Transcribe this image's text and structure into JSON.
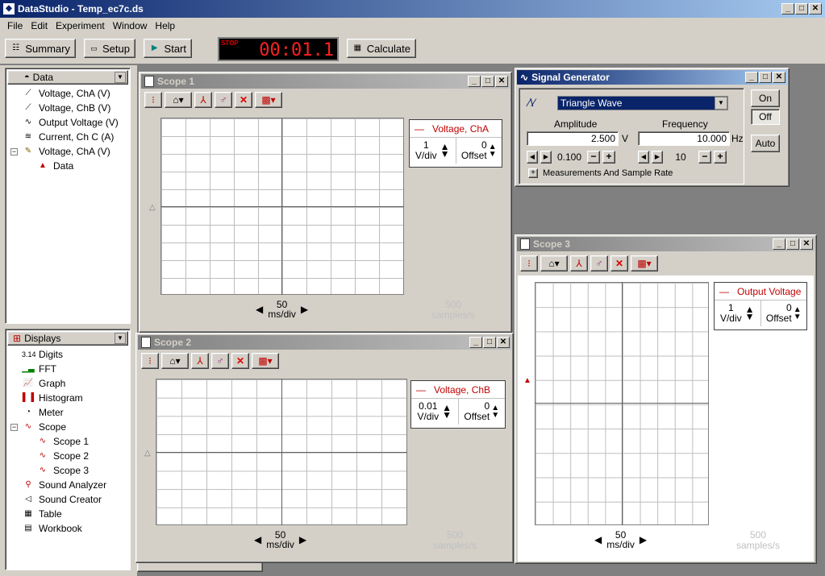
{
  "window": {
    "title": "DataStudio - Temp_ec7c.ds",
    "app_icon": "datastudio-icon"
  },
  "menu": [
    "File",
    "Edit",
    "Experiment",
    "Window",
    "Help"
  ],
  "toolbar": {
    "summary": "Summary",
    "setup": "Setup",
    "start": "Start",
    "timer": "00:01.1",
    "stop": "STOP",
    "calculate": "Calculate"
  },
  "data_panel": {
    "header": "Data",
    "items": [
      "Voltage, ChA (V)",
      "Voltage, ChB (V)",
      "Output Voltage (V)",
      "Current, Ch C (A)",
      "Voltage, ChA (V)",
      "Data"
    ]
  },
  "displays_panel": {
    "header": "Displays",
    "items": [
      "Digits",
      "FFT",
      "Graph",
      "Histogram",
      "Meter",
      "Scope",
      "Scope 1",
      "Scope 2",
      "Scope 3",
      "Sound Analyzer",
      "Sound Creator",
      "Table",
      "Workbook"
    ],
    "digits_icon": "3.14"
  },
  "scope1": {
    "title": "Scope 1",
    "legend": "Voltage, ChA",
    "vdiv": "1",
    "vdiv_unit": "V/div",
    "offset": "0",
    "offset_label": "Offset",
    "time": "50",
    "time_unit": "ms/div",
    "rate": "500",
    "rate_unit": "samples/s"
  },
  "scope2": {
    "title": "Scope 2",
    "legend": "Voltage, ChB",
    "vdiv": "0.01",
    "vdiv_unit": "V/div",
    "offset": "0",
    "offset_label": "Offset",
    "time": "50",
    "time_unit": "ms/div",
    "rate": "500",
    "rate_unit": "samples/s"
  },
  "scope3": {
    "title": "Scope 3",
    "legend": "Output Voltage",
    "vdiv": "1",
    "vdiv_unit": "V/div",
    "offset": "0",
    "offset_label": "Offset",
    "time": "50",
    "time_unit": "ms/div",
    "rate": "500",
    "rate_unit": "samples/s"
  },
  "siggen": {
    "title": "Signal Generator",
    "wave": "Triangle Wave",
    "amplitude_label": "Amplitude",
    "amplitude": "2.500",
    "amp_unit": "V",
    "amp_step": "0.100",
    "frequency_label": "Frequency",
    "frequency": "10.000",
    "freq_unit": "Hz",
    "freq_step": "10",
    "on": "On",
    "off": "Off",
    "auto": "Auto",
    "measurements": "Measurements And Sample Rate"
  }
}
